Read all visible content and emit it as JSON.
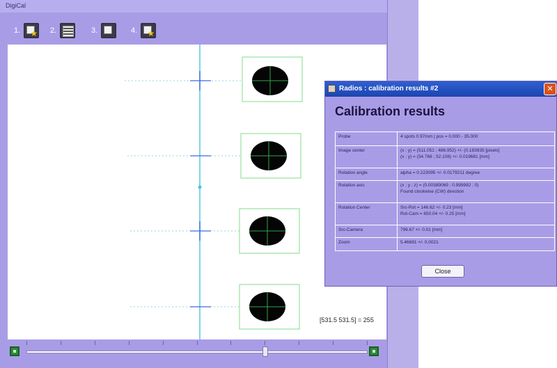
{
  "window": {
    "title": "DigiCal"
  },
  "toolbar": {
    "steps": [
      {
        "num": "1.",
        "icon": "target-star-icon"
      },
      {
        "num": "2.",
        "icon": "grid-icon"
      },
      {
        "num": "3.",
        "icon": "target-icon"
      },
      {
        "num": "4.",
        "icon": "target-star-icon"
      }
    ]
  },
  "canvas": {
    "coord_readout": "[531.5 531.5] = 255",
    "marker_count": 4
  },
  "slider": {
    "value_fraction": 0.7
  },
  "dialog": {
    "title": "Radios : calibration results #2",
    "heading": "Calibration results",
    "rows": [
      {
        "label": "Probe",
        "value": [
          "4 spots 0.97mm | pos = 0.000 - 35.000"
        ]
      },
      {
        "label": "Image center",
        "value": [
          "(x ; y) = (511.051 ; 486.952) +/- (0.183935 [pixels]",
          "(x ; y) = (54.768 ; 52.108) +/- 0.019681 [mm]"
        ]
      },
      {
        "label": "Rotation angle",
        "value": [
          "alpha = 0.223095 +/- 0.0179211 degree"
        ]
      },
      {
        "label": "Rotation axis",
        "value": [
          "(x ; y ; z) = (0.00389069 ; 0.999992 ; 0)",
          "Found clockwise (CW) direction"
        ]
      },
      {
        "label": "Rotation Center",
        "value": [
          "Src-Rot = 146.62 +/- 0.23 [mm]",
          "Rot-Cam = 650.04 +/- 0.25 [mm]"
        ]
      },
      {
        "label": "Src-Camera",
        "value": [
          "796.67 +/- 0.01 [mm]"
        ]
      },
      {
        "label": "Zoom",
        "value": [
          "5.46691 +/- 0.0021"
        ]
      }
    ],
    "close_label": "Close"
  },
  "colors": {
    "window_bg": "#a99ce6",
    "dialog_titlebar": "#2f5fd0",
    "close_x": "#d8531c",
    "calibration_line": "#49c5e0",
    "marker_box": "#7fdc8b",
    "crosshair": "#2fa84a"
  }
}
